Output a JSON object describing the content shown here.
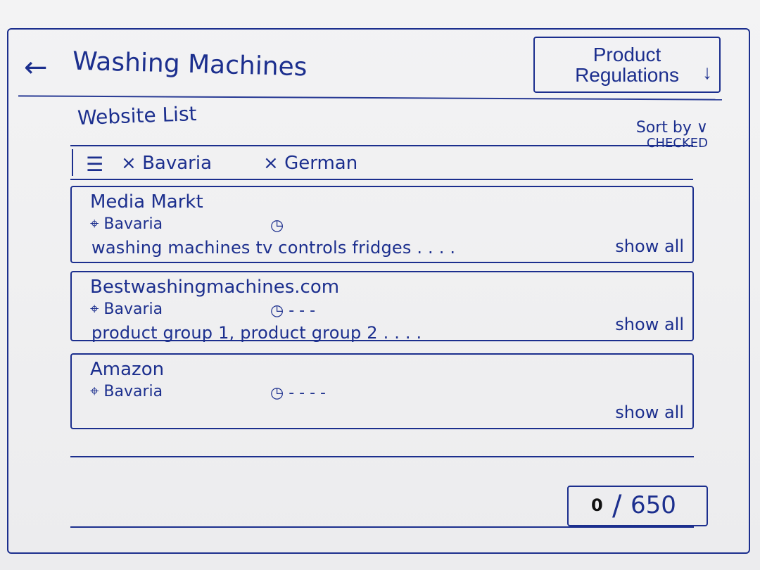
{
  "header": {
    "title": "Washing Machines",
    "back_icon": "arrow-left-icon",
    "product_regulations_label": "Product Regulations",
    "product_regulations_icon": "chevron-down-icon"
  },
  "website_list": {
    "title": "Website List",
    "sort_label": "Sort by",
    "sort_value": "CHECKED",
    "filters": [
      "Bavaria",
      "German"
    ]
  },
  "cards": [
    {
      "title": "Media Markt",
      "location": "Bavaria",
      "time_icon": "clock-icon",
      "time_text": "",
      "groups": "washing machines   tv controls   fridges . . . .",
      "show_all": "show all"
    },
    {
      "title": "Bestwashingmachines.com",
      "location": "Bavaria",
      "time_icon": "clock-icon",
      "time_text": "- - -",
      "groups": "product group 1,  product group 2 . . . .",
      "show_all": "show all"
    },
    {
      "title": "Amazon",
      "location": "Bavaria",
      "time_icon": "clock-icon",
      "time_text": "- - - -",
      "groups": "",
      "show_all": "show all"
    }
  ],
  "footer": {
    "current": "0",
    "total": "650"
  },
  "colors": {
    "ink": "#1c2f8e",
    "paper": "#f3f3f4",
    "counter_text": "#111111"
  }
}
